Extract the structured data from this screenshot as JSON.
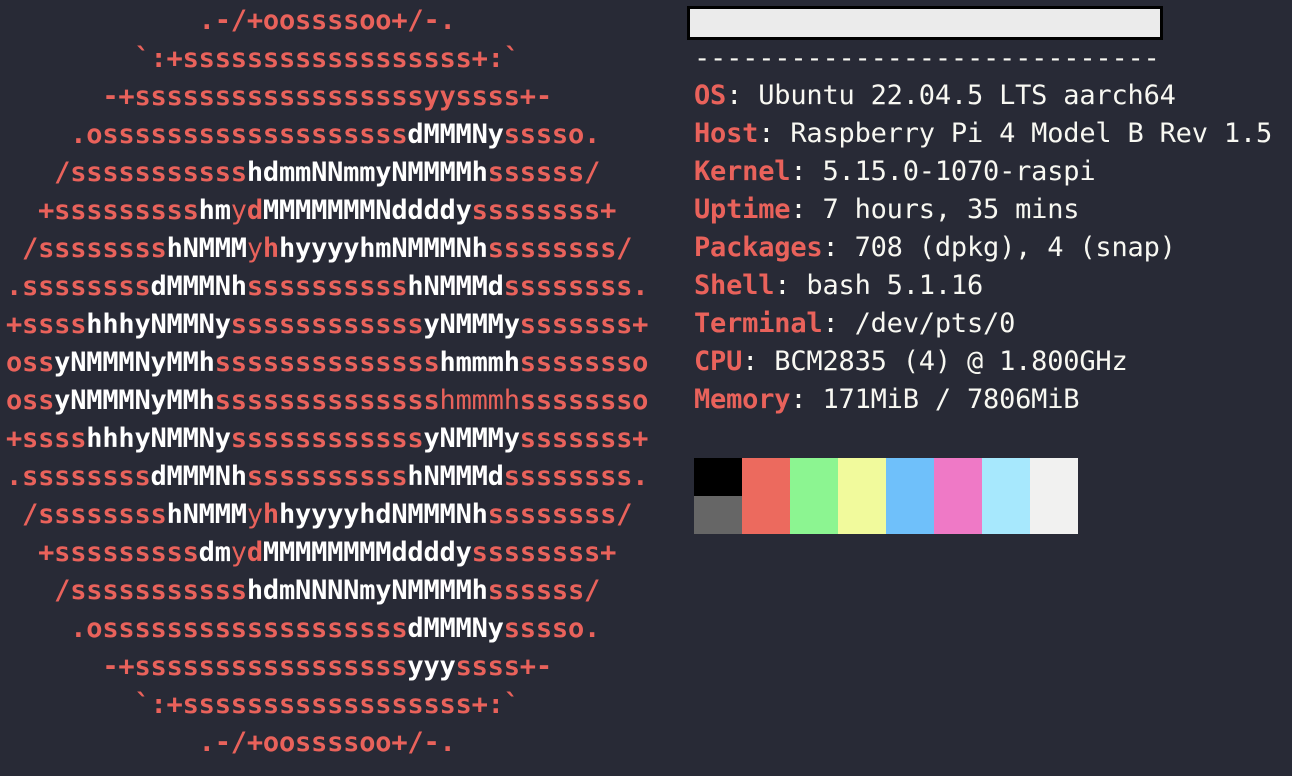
{
  "logo": {
    "lines": [
      [
        [
          "c1",
          "            .-/+oossssoo+/-."
        ]
      ],
      [
        [
          "c1",
          "        `:+ssssssssssssssssss+:`"
        ]
      ],
      [
        [
          "c1",
          "      -+ssssssssssssssssssyyssss+-"
        ]
      ],
      [
        [
          "c1",
          "    .osssssssssssssssssss"
        ],
        [
          "c2",
          "dMMMNy"
        ],
        [
          "c1",
          "sssso."
        ]
      ],
      [
        [
          "c1",
          "   /sssssssssss"
        ],
        [
          "c2",
          "hdmmNNmmyNMMMMh"
        ],
        [
          "c1",
          "ssssss/"
        ]
      ],
      [
        [
          "c1",
          "  +sssssssss"
        ],
        [
          "c2",
          "hm"
        ],
        [
          "c3",
          "y"
        ],
        [
          "c1",
          "d"
        ],
        [
          "c2",
          "MMMMMMMNddddy"
        ],
        [
          "c1",
          "ssssssss+"
        ]
      ],
      [
        [
          "c1",
          " /ssssssss"
        ],
        [
          "c2",
          "hNMMM"
        ],
        [
          "c3",
          "y"
        ],
        [
          "c1",
          "h"
        ],
        [
          "c2",
          "hyyyyhmNMMMNh"
        ],
        [
          "c1",
          "ssssssss/"
        ]
      ],
      [
        [
          "c1",
          ".ssssssss"
        ],
        [
          "c2",
          "dMMMNh"
        ],
        [
          "c1",
          "ssssssssss"
        ],
        [
          "c2",
          "hNMMMd"
        ],
        [
          "c1",
          "ssssssss."
        ]
      ],
      [
        [
          "c1",
          "+ssss"
        ],
        [
          "c2",
          "hhhyNMMNy"
        ],
        [
          "c1",
          "ssssssssssss"
        ],
        [
          "c2",
          "yNMMMy"
        ],
        [
          "c1",
          "sssssss+"
        ]
      ],
      [
        [
          "c1",
          "oss"
        ],
        [
          "c2",
          "yNMMMNyMMh"
        ],
        [
          "c1",
          "ssssssssssssss"
        ],
        [
          "c2",
          "hmmmh"
        ],
        [
          "c1",
          "ssssssso"
        ]
      ],
      [
        [
          "c1",
          "oss"
        ],
        [
          "c2",
          "yNMMMNyMMh"
        ],
        [
          "c1",
          "ssssssssssssss"
        ],
        [
          "c3",
          "hmmmh"
        ],
        [
          "c1",
          "ssssssso"
        ]
      ],
      [
        [
          "c1",
          "+ssss"
        ],
        [
          "c2",
          "hhhyNMMNy"
        ],
        [
          "c1",
          "ssssssssssss"
        ],
        [
          "c2",
          "yNMMMy"
        ],
        [
          "c1",
          "sssssss+"
        ]
      ],
      [
        [
          "c1",
          ".ssssssss"
        ],
        [
          "c2",
          "dMMMNh"
        ],
        [
          "c1",
          "ssssssssss"
        ],
        [
          "c2",
          "hNMMMd"
        ],
        [
          "c1",
          "ssssssss."
        ]
      ],
      [
        [
          "c1",
          " /ssssssss"
        ],
        [
          "c2",
          "hNMMM"
        ],
        [
          "c3",
          "y"
        ],
        [
          "c1",
          "h"
        ],
        [
          "c2",
          "hyyyyhdNMMMNh"
        ],
        [
          "c1",
          "ssssssss/"
        ]
      ],
      [
        [
          "c1",
          "  +sssssssss"
        ],
        [
          "c2",
          "dm"
        ],
        [
          "c3",
          "y"
        ],
        [
          "c1",
          "d"
        ],
        [
          "c2",
          "MMMMMMMMddddy"
        ],
        [
          "c1",
          "ssssssss+"
        ]
      ],
      [
        [
          "c1",
          "   /sssssssssss"
        ],
        [
          "c2",
          "hdmNNNNmyNMMMMh"
        ],
        [
          "c1",
          "ssssss/"
        ]
      ],
      [
        [
          "c1",
          "    .osssssssssssssssssss"
        ],
        [
          "c2",
          "dMMMNy"
        ],
        [
          "c1",
          "sssso."
        ]
      ],
      [
        [
          "c1",
          "      -+sssssssssssssssss"
        ],
        [
          "c2",
          "yyy"
        ],
        [
          "c1",
          "ssss+-"
        ]
      ],
      [
        [
          "c1",
          "        `:+ssssssssssssssssss+:`"
        ]
      ],
      [
        [
          "c1",
          "            .-/+oossssoo+/-."
        ]
      ]
    ]
  },
  "info": {
    "separator": "-----------------------------",
    "rows": [
      {
        "key": "OS",
        "value": " Ubuntu 22.04.5 LTS aarch64"
      },
      {
        "key": "Host",
        "value": " Raspberry Pi 4 Model B Rev 1.5"
      },
      {
        "key": "Kernel",
        "value": " 5.15.0-1070-raspi"
      },
      {
        "key": "Uptime",
        "value": " 7 hours, 35 mins"
      },
      {
        "key": "Packages",
        "value": " 708 (dpkg), 4 (snap)"
      },
      {
        "key": "Shell",
        "value": " bash 5.1.16"
      },
      {
        "key": "Terminal",
        "value": " /dev/pts/0"
      },
      {
        "key": "CPU",
        "value": " BCM2835 (4) @ 1.800GHz"
      },
      {
        "key": "Memory",
        "value": " 171MiB / 7806MiB"
      }
    ]
  },
  "palette": {
    "top": [
      "#000000",
      "#ec6a5e",
      "#8cf591",
      "#f1fa9c",
      "#6fc0fa",
      "#ef79c6",
      "#a7e8fd",
      "#f1f1f0"
    ],
    "bottom": [
      "#666666",
      "#ec6a5e",
      "#8cf591",
      "#f1fa9c",
      "#6fc0fa",
      "#ef79c6",
      "#a7e8fd",
      "#f1f1f0"
    ]
  }
}
